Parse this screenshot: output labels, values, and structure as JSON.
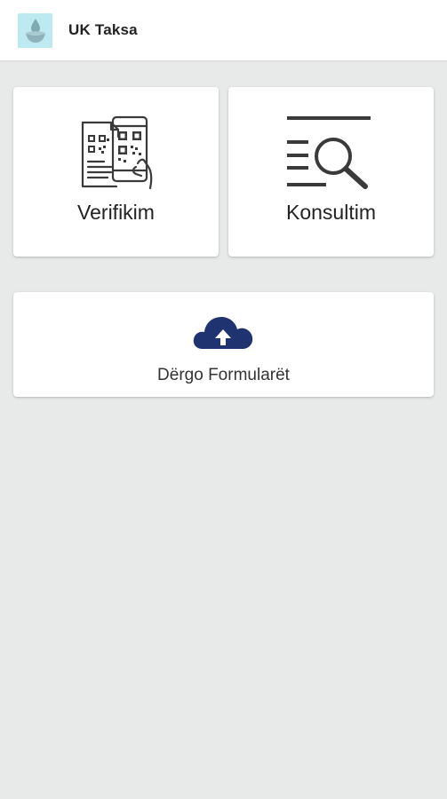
{
  "app": {
    "title": "UK Taksa",
    "logo_icon": "water-drop-bowl-icon",
    "bar_color": "#ffffff",
    "background_color": "#e8e9e9"
  },
  "cards": {
    "verifikim": {
      "label": "Verifikim",
      "icon": "qr-document-phone-icon"
    },
    "konsultim": {
      "label": "Konsultim",
      "icon": "list-search-icon"
    },
    "dergo": {
      "label": "Dërgo Formularët",
      "icon": "cloud-upload-icon",
      "icon_color": "#1e3370"
    }
  }
}
